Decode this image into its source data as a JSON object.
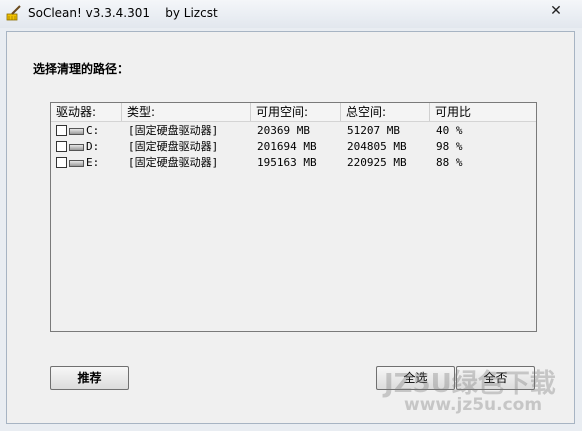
{
  "window": {
    "title": "SoClean! v3.3.4.301    by Lizcst",
    "close_glyph": "✕"
  },
  "main": {
    "path_label": "选择清理的路径："
  },
  "drive_list": {
    "columns": [
      "驱动器:",
      "类型:",
      "可用空间:",
      "总空间:",
      "可用比"
    ],
    "rows": [
      {
        "drive": "C:",
        "type": "[固定硬盘驱动器]",
        "free": "20369 MB",
        "total": "51207 MB",
        "ratio": "40 %"
      },
      {
        "drive": "D:",
        "type": "[固定硬盘驱动器]",
        "free": "201694 MB",
        "total": "204805 MB",
        "ratio": "98 %"
      },
      {
        "drive": "E:",
        "type": "[固定硬盘驱动器]",
        "free": "195163 MB",
        "total": "220925 MB",
        "ratio": "88 %"
      }
    ]
  },
  "buttons": {
    "recommend": "推荐",
    "select_all": "全选",
    "select_none": "全否"
  },
  "watermark": {
    "line1": "JZ5U绿色下载",
    "line2": "www.jz5u.com"
  }
}
